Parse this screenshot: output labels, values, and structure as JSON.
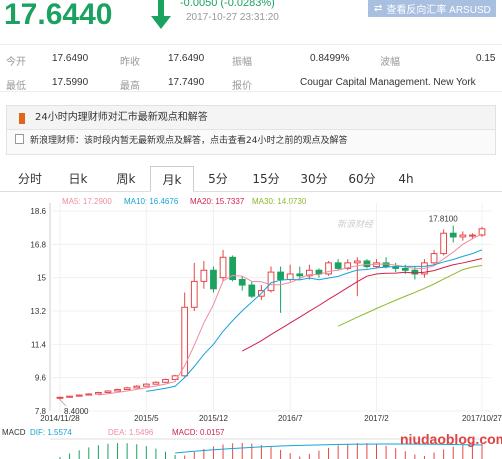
{
  "header": {
    "price": "17.6440",
    "change": "-0.0050 (-0.0283%)",
    "timestamp": "2017-10-27 23:31:20",
    "reverse_button": "查看反向汇率 ARSUSD"
  },
  "stats": [
    {
      "label": "今开",
      "value": "17.6490"
    },
    {
      "label": "昨收",
      "value": "17.6490"
    },
    {
      "label": "振幅",
      "value": "0.8499%"
    },
    {
      "label": "波幅",
      "value": "0.15"
    },
    {
      "label": "最低",
      "value": "17.5990"
    },
    {
      "label": "最高",
      "value": "17.7490"
    },
    {
      "label": "报价",
      "value": "Cougar Capital Management. New York"
    }
  ],
  "news": {
    "title": "24小时内理财师对汇市最新观点和解答",
    "line": "新浪理财师：该时段内暂无最新观点及解答，点击查看24小时之前的观点及解答"
  },
  "tabs": [
    "分时",
    "日k",
    "周k",
    "月k",
    "5分",
    "15分",
    "30分",
    "60分",
    "4h"
  ],
  "active_tab": "月k",
  "watermark": "新浪财经",
  "watermark2": "niudaoblog.com",
  "colors": {
    "up": "#e64646",
    "down": "#1aa260",
    "ma5": "#f08ca0",
    "ma10": "#16a4d8",
    "ma20": "#d21f4c",
    "ma30": "#8db82b",
    "accent": "#a8bfe0"
  },
  "ma_legend": {
    "ma5": "MA5: 17.2900",
    "ma10": "MA10: 16.4676",
    "ma20": "MA20: 15.7337",
    "ma30": "MA30: 14.0730"
  },
  "macd_legend": {
    "macd": "MACD",
    "dif": "DIF: 1.5574",
    "dea": "DEA: 1.5496",
    "value": "MACD: 0.0157"
  },
  "chart_data": {
    "type": "candlestick",
    "ylim": [
      7.8,
      18.6
    ],
    "y_ticks": [
      "18.6",
      "16.8",
      "15",
      "13.2",
      "11.4",
      "9.6",
      "7.8"
    ],
    "x_ticks": [
      "2014/11/28",
      "2015/5",
      "2015/12",
      "2016/7",
      "2017/2",
      "2017/10/27"
    ],
    "annotations": [
      {
        "text": "17.8100",
        "type": "max"
      },
      {
        "text": "8.4000",
        "type": "min"
      }
    ],
    "candles": [
      {
        "o": 8.5,
        "c": 8.54,
        "h": 8.56,
        "l": 8.4
      },
      {
        "o": 8.54,
        "c": 8.6,
        "h": 8.62,
        "l": 8.52
      },
      {
        "o": 8.6,
        "c": 8.66,
        "h": 8.7,
        "l": 8.58
      },
      {
        "o": 8.66,
        "c": 8.72,
        "h": 8.76,
        "l": 8.64
      },
      {
        "o": 8.72,
        "c": 8.8,
        "h": 8.84,
        "l": 8.7
      },
      {
        "o": 8.8,
        "c": 8.88,
        "h": 8.92,
        "l": 8.78
      },
      {
        "o": 8.88,
        "c": 8.96,
        "h": 9.0,
        "l": 8.86
      },
      {
        "o": 8.96,
        "c": 9.05,
        "h": 9.1,
        "l": 8.94
      },
      {
        "o": 9.05,
        "c": 9.14,
        "h": 9.2,
        "l": 9.02
      },
      {
        "o": 9.14,
        "c": 9.25,
        "h": 9.3,
        "l": 9.12
      },
      {
        "o": 9.25,
        "c": 9.35,
        "h": 9.4,
        "l": 9.22
      },
      {
        "o": 9.35,
        "c": 9.5,
        "h": 9.55,
        "l": 9.33
      },
      {
        "o": 9.5,
        "c": 9.7,
        "h": 9.75,
        "l": 9.48
      },
      {
        "o": 9.7,
        "c": 13.4,
        "h": 14.2,
        "l": 9.65
      },
      {
        "o": 13.4,
        "c": 14.8,
        "h": 15.8,
        "l": 13.2
      },
      {
        "o": 14.8,
        "c": 15.4,
        "h": 15.9,
        "l": 14.4
      },
      {
        "o": 15.4,
        "c": 14.4,
        "h": 15.6,
        "l": 14.2
      },
      {
        "o": 15.0,
        "c": 16.1,
        "h": 16.5,
        "l": 14.8
      },
      {
        "o": 16.1,
        "c": 14.9,
        "h": 16.2,
        "l": 14.8
      },
      {
        "o": 14.9,
        "c": 14.6,
        "h": 15.1,
        "l": 14.3
      },
      {
        "o": 14.6,
        "c": 14.0,
        "h": 14.8,
        "l": 13.9
      },
      {
        "o": 14.0,
        "c": 14.3,
        "h": 14.6,
        "l": 13.8
      },
      {
        "o": 14.3,
        "c": 15.3,
        "h": 15.6,
        "l": 14.2
      },
      {
        "o": 15.3,
        "c": 14.9,
        "h": 15.6,
        "l": 13.1
      },
      {
        "o": 14.9,
        "c": 15.2,
        "h": 15.7,
        "l": 14.8
      },
      {
        "o": 15.2,
        "c": 15.1,
        "h": 15.6,
        "l": 14.9
      },
      {
        "o": 15.1,
        "c": 15.4,
        "h": 15.7,
        "l": 14.9
      },
      {
        "o": 15.4,
        "c": 15.2,
        "h": 15.5,
        "l": 15.0
      },
      {
        "o": 15.2,
        "c": 15.8,
        "h": 15.9,
        "l": 15.1
      },
      {
        "o": 15.8,
        "c": 15.5,
        "h": 16.0,
        "l": 15.4
      },
      {
        "o": 15.5,
        "c": 15.8,
        "h": 16.0,
        "l": 15.4
      },
      {
        "o": 15.8,
        "c": 15.9,
        "h": 16.1,
        "l": 14.0
      },
      {
        "o": 15.9,
        "c": 15.6,
        "h": 16.0,
        "l": 15.5
      },
      {
        "o": 15.6,
        "c": 15.8,
        "h": 16.0,
        "l": 15.5
      },
      {
        "o": 15.8,
        "c": 15.6,
        "h": 16.1,
        "l": 15.5
      },
      {
        "o": 15.6,
        "c": 15.5,
        "h": 15.8,
        "l": 15.3
      },
      {
        "o": 15.5,
        "c": 15.4,
        "h": 15.7,
        "l": 15.2
      },
      {
        "o": 15.4,
        "c": 15.2,
        "h": 15.6,
        "l": 14.9
      },
      {
        "o": 15.2,
        "c": 15.8,
        "h": 16.0,
        "l": 15.0
      },
      {
        "o": 15.8,
        "c": 16.3,
        "h": 16.5,
        "l": 15.7
      },
      {
        "o": 16.3,
        "c": 17.4,
        "h": 17.6,
        "l": 16.2
      },
      {
        "o": 17.4,
        "c": 17.2,
        "h": 17.81,
        "l": 16.9
      },
      {
        "o": 17.2,
        "c": 17.3,
        "h": 17.5,
        "l": 17.0
      },
      {
        "o": 17.3,
        "c": 17.3,
        "h": 17.4,
        "l": 17.1
      },
      {
        "o": 17.3,
        "c": 17.64,
        "h": 17.75,
        "l": 17.2
      }
    ]
  }
}
